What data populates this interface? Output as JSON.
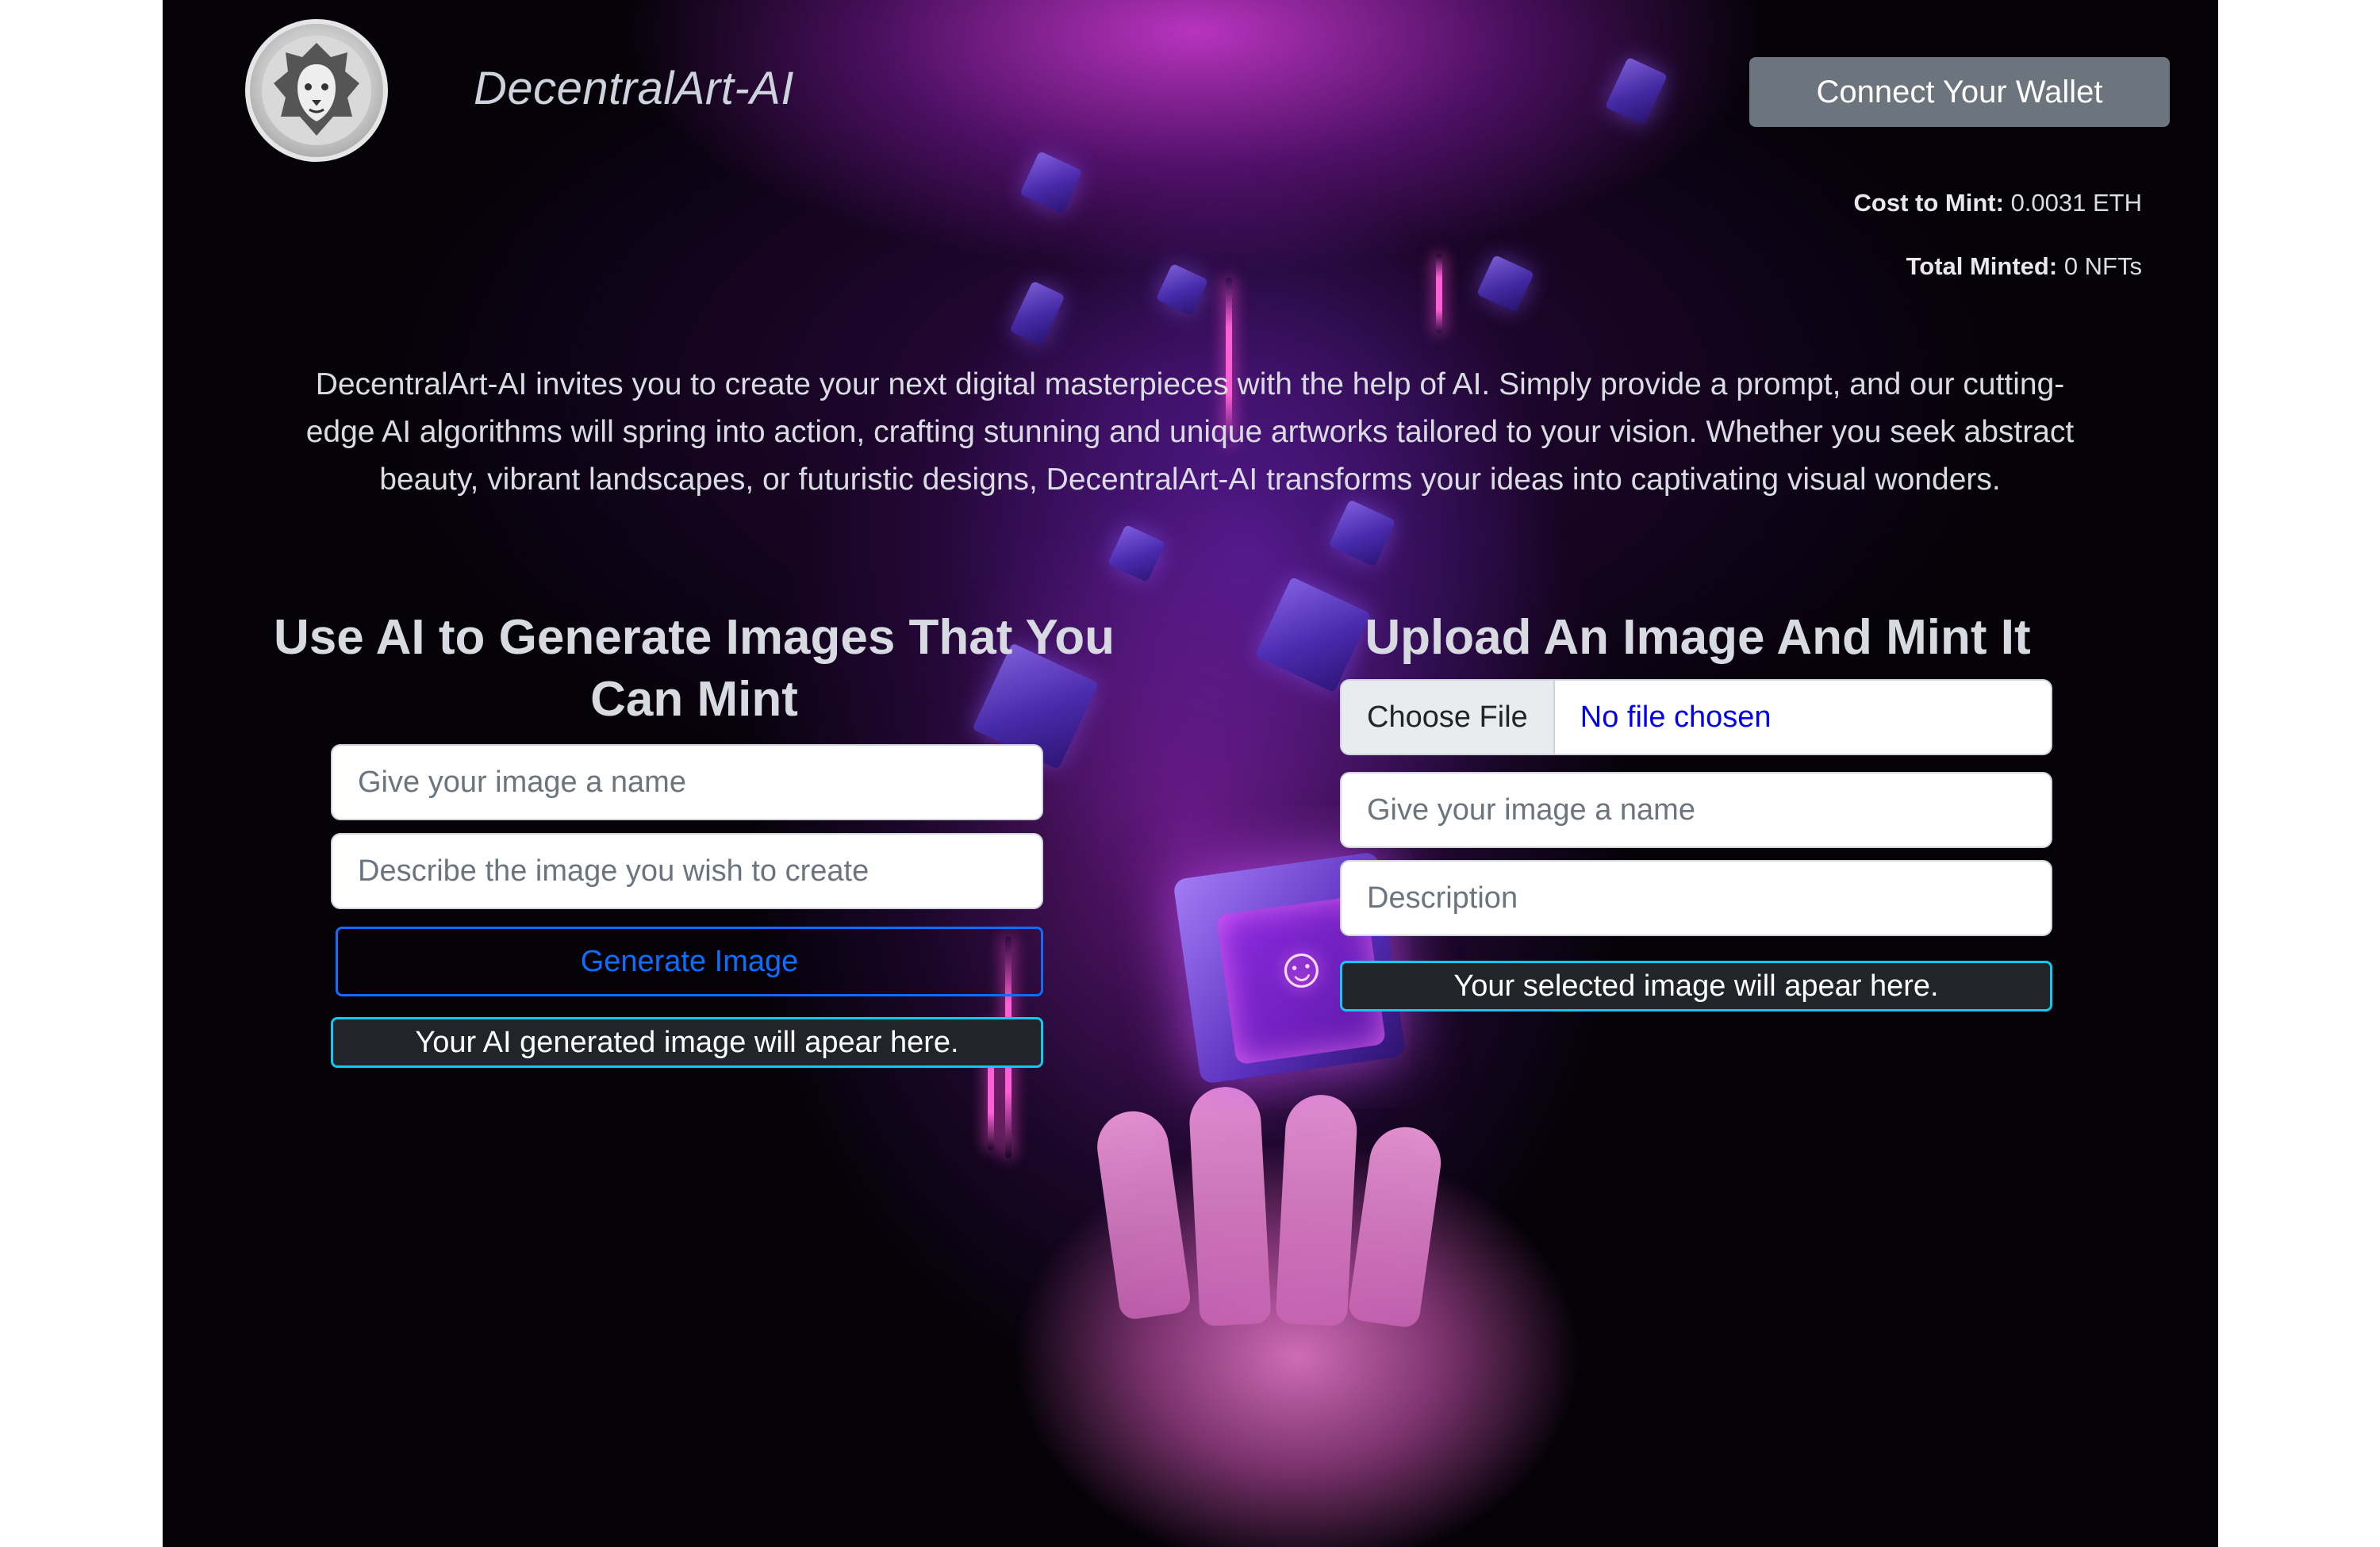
{
  "header": {
    "brand": "DecentralArt-AI",
    "connect_wallet_label": "Connect Your Wallet",
    "cost_label": "Cost to Mint:",
    "cost_value": "0.0031 ETH",
    "minted_label": "Total Minted:",
    "minted_value": "0 NFTs"
  },
  "intro": "DecentralArt-AI invites you to create your next digital masterpieces with the help of AI. Simply provide a prompt, and our cutting-edge AI algorithms will spring into action, crafting stunning and unique artworks tailored to your vision. Whether you seek abstract beauty, vibrant landscapes, or futuristic designs, DecentralArt-AI transforms your ideas into captivating visual wonders.",
  "generate_section": {
    "title": "Use AI to Generate Images That You Can Mint",
    "name_placeholder": "Give your image a name",
    "prompt_placeholder": "Describe the image you wish to create",
    "generate_button": "Generate Image",
    "result_notice": "Your AI generated image will apear here."
  },
  "upload_section": {
    "title": "Upload An Image And Mint It",
    "choose_file_label": "Choose File",
    "no_file_label": "No file chosen",
    "name_placeholder": "Give your image a name",
    "description_placeholder": "Description",
    "result_notice": "Your selected image will apear here."
  },
  "colors": {
    "connect_button": "#6c757d",
    "primary": "#0d6efd",
    "notice_border": "#0dcaf0",
    "notice_bg": "#212529"
  }
}
